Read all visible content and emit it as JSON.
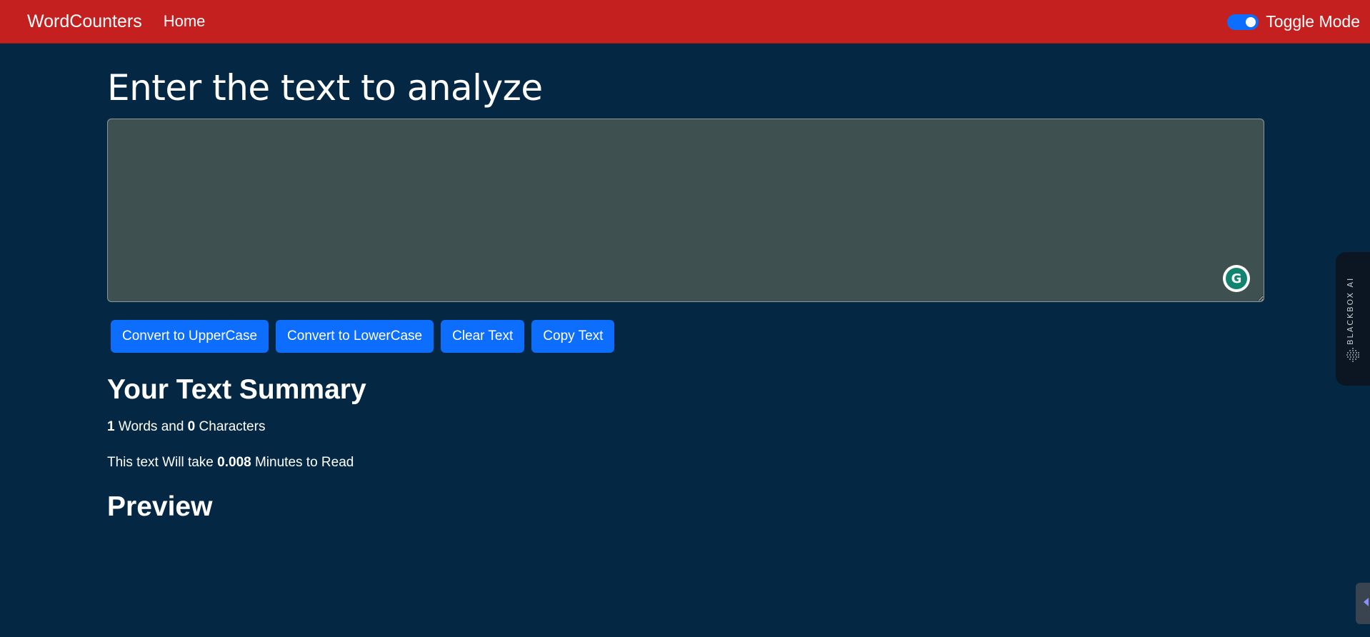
{
  "navbar": {
    "brand": "WordCounters",
    "links": [
      {
        "label": "Home"
      }
    ],
    "toggle_label": "Toggle Mode",
    "toggle_on": true
  },
  "main": {
    "title": "Enter the text to analyze",
    "textarea_value": "",
    "buttons": {
      "uppercase": "Convert to UpperCase",
      "lowercase": "Convert to LowerCase",
      "clear": "Clear Text",
      "copy": "Copy Text"
    },
    "summary": {
      "title": "Your Text Summary",
      "word_count": "1",
      "words_and": "Words and",
      "char_count": "0",
      "characters": "Characters",
      "read_prefix": "This text Will take",
      "read_minutes": "0.008",
      "read_suffix": "Minutes to Read"
    },
    "preview": {
      "title": "Preview",
      "text": ""
    }
  },
  "extensions": {
    "blackbox_label": "BLACKBOX AI",
    "grammarly_icon": "grammarly-icon"
  },
  "colors": {
    "navbar": "#c42020",
    "background": "#042743",
    "textarea": "#3f5050",
    "button": "#0d6efd"
  }
}
